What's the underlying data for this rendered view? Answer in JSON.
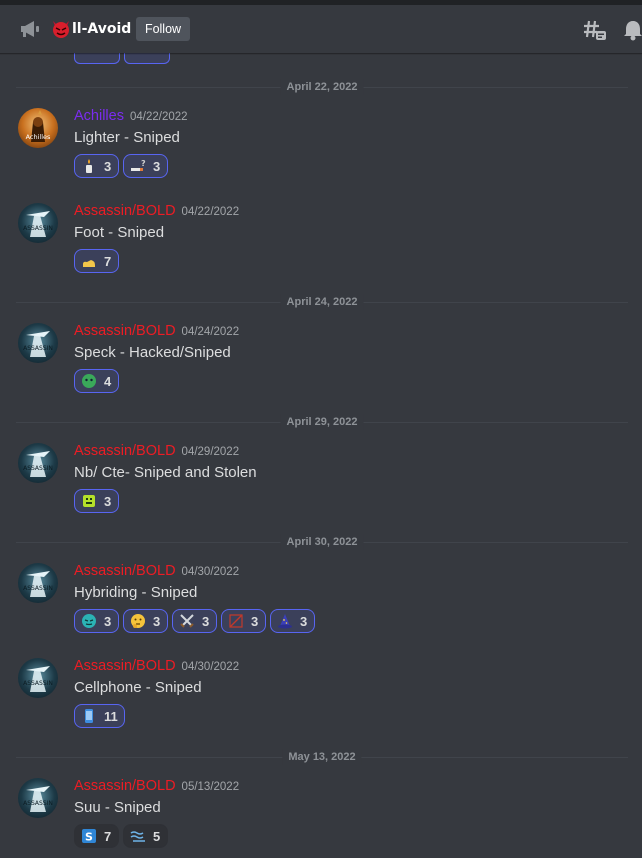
{
  "header": {
    "channel_name": "ll-Avoid",
    "follow_label": "Follow",
    "icons": [
      "announcement-megaphone-icon",
      "devil-emoji-icon",
      "threads-icon",
      "notification-bell-icon"
    ]
  },
  "dividers": [
    "April 22, 2022",
    "April 24, 2022",
    "April 29, 2022",
    "April 30, 2022",
    "May 13, 2022"
  ],
  "messages": [
    {
      "author": "Achilles",
      "timestamp": "04/22/2022",
      "content": "Lighter - Sniped",
      "author_color": "#7b2cf0",
      "reactions": [
        {
          "emoji": "candle-emoji",
          "count": "3",
          "me": true
        },
        {
          "emoji": "cigarette-question-emoji",
          "count": "3",
          "me": true
        }
      ]
    },
    {
      "author": "Assassin/BOLD",
      "timestamp": "04/22/2022",
      "content": "Foot - Sniped",
      "author_color": "#ed1c24",
      "reactions": [
        {
          "emoji": "foot-emoji",
          "count": "7",
          "me": true
        }
      ]
    },
    {
      "author": "Assassin/BOLD",
      "timestamp": "04/24/2022",
      "content": "Speck - Hacked/Sniped",
      "author_color": "#ed1c24",
      "reactions": [
        {
          "emoji": "green-face-emoji",
          "count": "4",
          "me": true
        }
      ]
    },
    {
      "author": "Assassin/BOLD",
      "timestamp": "04/29/2022",
      "content": "Nb/ Cte- Sniped and Stolen",
      "author_color": "#ed1c24",
      "reactions": [
        {
          "emoji": "green-block-emoji",
          "count": "3",
          "me": true
        }
      ]
    },
    {
      "author": "Assassin/BOLD",
      "timestamp": "04/30/2022",
      "content": "Hybriding - Sniped",
      "author_color": "#ed1c24",
      "reactions": [
        {
          "emoji": "teal-face-emoji",
          "count": "3",
          "me": true
        },
        {
          "emoji": "thinking-face-emoji",
          "count": "3",
          "me": true
        },
        {
          "emoji": "crossed-swords-emoji",
          "count": "3",
          "me": true
        },
        {
          "emoji": "crossed-bow-emoji",
          "count": "3",
          "me": true
        },
        {
          "emoji": "wizard-hat-emoji",
          "count": "3",
          "me": true
        }
      ]
    },
    {
      "author": "Assassin/BOLD",
      "timestamp": "04/30/2022",
      "content": "Cellphone - Sniped",
      "author_color": "#ed1c24",
      "reactions": [
        {
          "emoji": "blue-phone-emoji",
          "count": "11",
          "me": true
        }
      ]
    },
    {
      "author": "Assassin/BOLD",
      "timestamp": "05/13/2022",
      "content": "Suu - Sniped",
      "author_color": "#ed1c24",
      "reactions": [
        {
          "emoji": "blue-s-emoji",
          "count": "7",
          "me": false
        },
        {
          "emoji": "wavy-lines-emoji",
          "count": "5",
          "me": false
        }
      ]
    }
  ],
  "colors": {
    "background": "#36393f",
    "reaction_active_border": "#5865f2",
    "divider_text": "#8e9297"
  }
}
